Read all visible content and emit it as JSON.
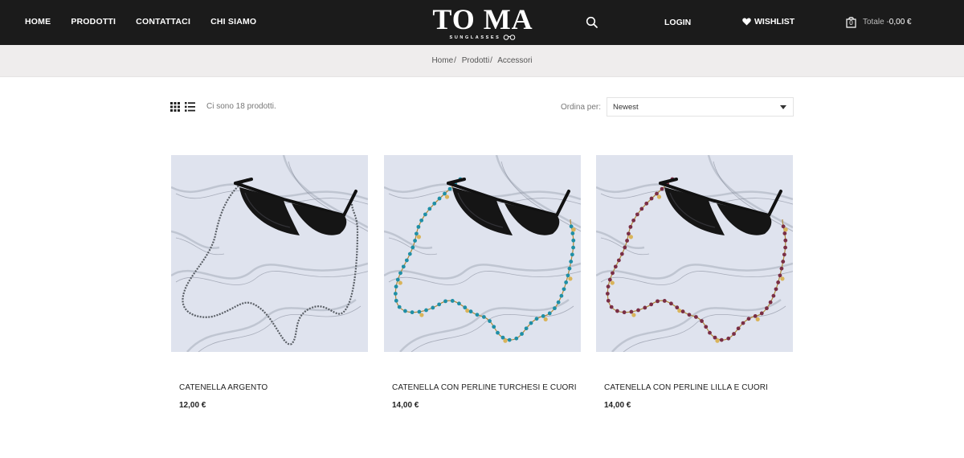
{
  "header": {
    "nav": [
      {
        "label": "HOME"
      },
      {
        "label": "PRODOTTI"
      },
      {
        "label": "CONTATTACI"
      },
      {
        "label": "CHI SIAMO"
      }
    ],
    "logo_text": "TO MA",
    "logo_subtitle": "SUNGLASSES",
    "login_label": "LOGIN",
    "wishlist_label": "WISHLIST",
    "cart_count": "0",
    "cart_total_label": "Totale -",
    "cart_total_value": "0,00 €"
  },
  "breadcrumb": [
    {
      "label": "Home"
    },
    {
      "label": "Prodotti"
    },
    {
      "label": "Accessori"
    }
  ],
  "toolbar": {
    "count_text": "Ci sono 18 prodotti.",
    "sort_label": "Ordina per:",
    "sort_value": "Newest"
  },
  "products": [
    {
      "name": "CATENELLA ARGENTO",
      "price": "12,00 €",
      "chain_color": "#5a5f66",
      "bead_color": "#6b7078"
    },
    {
      "name": "CATENELLA CON PERLINE TURCHESI E CUORI",
      "price": "14,00 €",
      "chain_color": "#b08a3a",
      "bead_color": "#1f8fa6"
    },
    {
      "name": "CATENELLA CON PERLINE LILLA E CUORI",
      "price": "14,00 €",
      "chain_color": "#b08a3a",
      "bead_color": "#7a2e45"
    }
  ],
  "icons": {
    "search": "search-icon",
    "wishlist": "heart-icon",
    "cart": "shopping-bag-icon",
    "grid_view": "grid-view-icon",
    "list_view": "list-view-icon",
    "sort": "chevron-down-icon"
  },
  "colors": {
    "header_bg": "#1b1b1b",
    "breadcrumb_bg": "#efeded",
    "marble_bg": "#dfe3ee"
  }
}
